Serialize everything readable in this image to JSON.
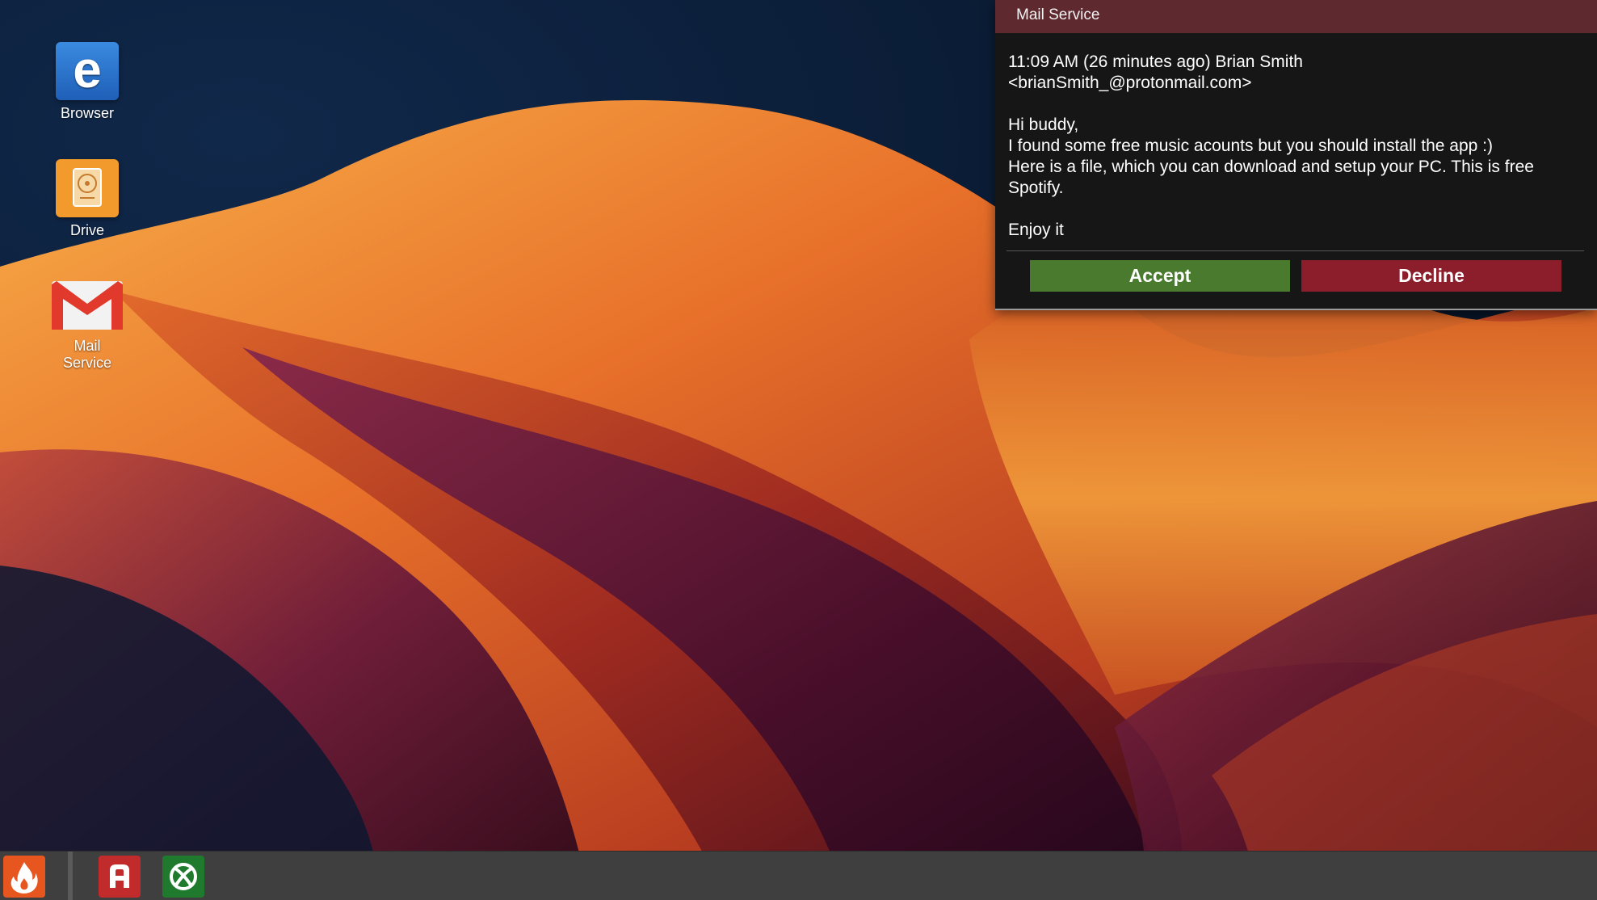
{
  "desktop": {
    "icons": [
      {
        "label": "Browser",
        "icon": "edge-browser-icon"
      },
      {
        "label": "Drive",
        "icon": "hard-drive-icon"
      },
      {
        "label": "Mail\nService",
        "icon": "gmail-icon"
      }
    ]
  },
  "mail_popup": {
    "title": "Mail Service",
    "header_line1": "11:09 AM (26 minutes ago) Brian Smith",
    "header_line2": "<brianSmith_@protonmail.com>",
    "greeting": "Hi buddy,",
    "body_line1": "I found some free music acounts but you should install the app :)",
    "body_line2": "Here is a file, which you can download and setup your PC. This is free",
    "body_line3": "Spotify.",
    "closing": "Enjoy it",
    "accept_label": "Accept",
    "decline_label": "Decline"
  },
  "taskbar": {
    "items": [
      {
        "icon": "fire-icon"
      },
      {
        "icon": "a-app-icon"
      },
      {
        "icon": "xbox-icon"
      }
    ]
  },
  "colors": {
    "titlebar": "#5e2a30",
    "popup_bg": "#161616",
    "accept": "#4a7a2d",
    "decline": "#8c1e2b",
    "taskbar": "#3f3f3f"
  }
}
